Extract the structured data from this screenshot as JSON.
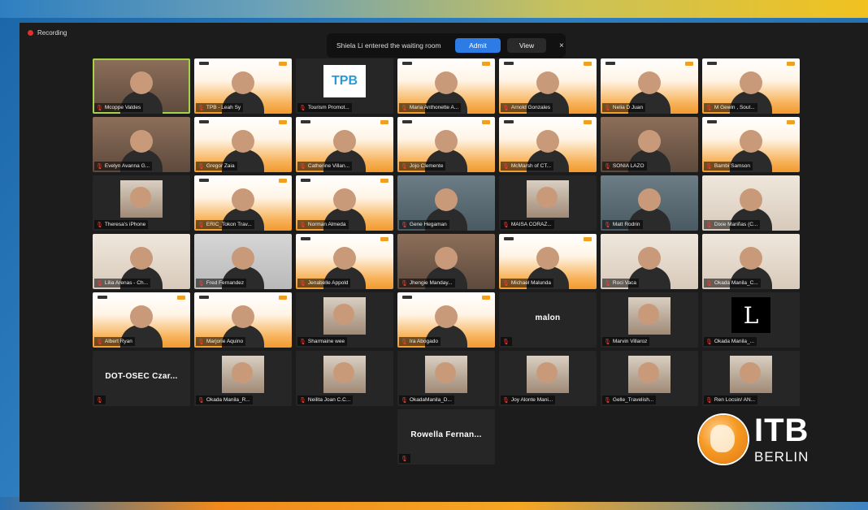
{
  "recording_label": "Recording",
  "notification": {
    "message": "Shiela Li entered the waiting room",
    "admit_label": "Admit",
    "view_label": "View",
    "close_symbol": "×"
  },
  "participants": [
    {
      "name": "Mcoppe Valdes",
      "style": "room",
      "active": true
    },
    {
      "name": "TPB - Leah Sy",
      "style": "orange"
    },
    {
      "name": "Tourism Promot...",
      "style": "tpb",
      "logo_text": "TPB"
    },
    {
      "name": "Maria Anthonette A...",
      "style": "orange"
    },
    {
      "name": "Arnold Gonzales",
      "style": "orange"
    },
    {
      "name": "Nelia D Juan",
      "style": "orange"
    },
    {
      "name": "M Gewin , Sout...",
      "style": "orange"
    },
    {
      "name": "Evelyn Avanna G...",
      "style": "room"
    },
    {
      "name": "Gregor Zaia",
      "style": "orange"
    },
    {
      "name": "Catherine Villan...",
      "style": "orange"
    },
    {
      "name": "Jojo Clemente",
      "style": "orange"
    },
    {
      "name": "McMarsh of CT...",
      "style": "orange"
    },
    {
      "name": "SONIA LAZO",
      "style": "room"
    },
    {
      "name": "Bambi Samson",
      "style": "orange"
    },
    {
      "name": "Theresa's iPhone",
      "style": "dark-photo"
    },
    {
      "name": "ERIC_Tokon Trav...",
      "style": "orange"
    },
    {
      "name": "Norman Almeda",
      "style": "orange"
    },
    {
      "name": "Gene Hegaman",
      "style": "office"
    },
    {
      "name": "MAISA CORAZ...",
      "style": "dark-photo"
    },
    {
      "name": "Matt Rodrin",
      "style": "office"
    },
    {
      "name": "Dixie Mariñas (C...",
      "style": "light"
    },
    {
      "name": "Lilia Arenas - Ch...",
      "style": "light"
    },
    {
      "name": "Fred Fernandez",
      "style": "gray"
    },
    {
      "name": "Jenabelle Appold",
      "style": "orange"
    },
    {
      "name": "Jhengie Manday...",
      "style": "room"
    },
    {
      "name": "Michael Malunda",
      "style": "orange"
    },
    {
      "name": "Roci Vaca",
      "style": "light"
    },
    {
      "name": "Okada Manila_C...",
      "style": "light"
    },
    {
      "name": "Albert Ryan",
      "style": "orange"
    },
    {
      "name": "Marjorie Aquino",
      "style": "orange"
    },
    {
      "name": "Sharmaine wee",
      "style": "dark-photo"
    },
    {
      "name": "Ira Abogado",
      "style": "orange"
    },
    {
      "name": "",
      "style": "bigname",
      "big_name": "malon"
    },
    {
      "name": "Marvin Villaroz",
      "style": "dark-photo"
    },
    {
      "name": "Okada Manila_...",
      "style": "L-logo",
      "logo_text": "L"
    },
    {
      "name": "",
      "style": "bigname",
      "big_name": "DOT-OSEC Czar..."
    },
    {
      "name": "Okada Manila_R...",
      "style": "dark-photo"
    },
    {
      "name": "Neilita Joan C.C...",
      "style": "dark-photo"
    },
    {
      "name": "OkadaManila_D...",
      "style": "dark-photo"
    },
    {
      "name": "Joy Alonte Mani...",
      "style": "dark-photo"
    },
    {
      "name": "Gelle_Travelish...",
      "style": "dark-photo"
    },
    {
      "name": "Ren Locsin/ AN...",
      "style": "dark-photo"
    },
    {
      "name": "",
      "style": "bigname",
      "big_name": "Rowella Fernan..."
    }
  ],
  "brand": {
    "name_main": "ITB",
    "name_sub": "BERLIN",
    "accent": "#f39a2d"
  }
}
